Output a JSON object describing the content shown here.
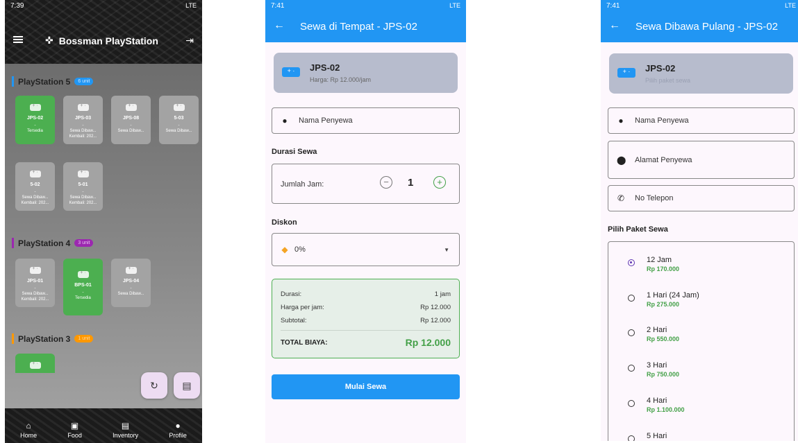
{
  "phone1": {
    "status": {
      "time": "7:39",
      "network": "LTE"
    },
    "app_title": "Bossman PlayStation",
    "sections": [
      {
        "name": "PlayStation 5",
        "badge": "6 unit",
        "color": "#2196f3",
        "units": [
          {
            "id": "JPS-02",
            "status": "Tersedia",
            "extra": "",
            "available": true
          },
          {
            "id": "JPS-03",
            "status": "Sewa Dibaw...",
            "extra": "Kembali: 202...",
            "available": false
          },
          {
            "id": "JPS-08",
            "status": "Sewa Dibaw...",
            "extra": "",
            "available": false
          },
          {
            "id": "5-03",
            "status": "Sewa Dibaw...",
            "extra": "",
            "available": false
          },
          {
            "id": "5-02",
            "status": "Sewa Dibaw...",
            "extra": "Kembali: 202...",
            "available": false
          },
          {
            "id": "5-01",
            "status": "Sewa Dibaw...",
            "extra": "Kembali: 202...",
            "available": false
          }
        ]
      },
      {
        "name": "PlayStation 4",
        "badge": "3 unit",
        "color": "#9c27b0",
        "units": [
          {
            "id": "JPS-01",
            "status": "Sewa Dibaw...",
            "extra": "Kembali: 202...",
            "available": false
          },
          {
            "id": "BPS-01",
            "status": "Tersedia",
            "extra": "",
            "available": true
          },
          {
            "id": "JPS-04",
            "status": "Sewa Dibaw...",
            "extra": "",
            "available": false
          }
        ]
      },
      {
        "name": "PlayStation 3",
        "badge": "1 unit",
        "color": "#ff9800",
        "units": []
      }
    ],
    "nav": [
      "Home",
      "Food",
      "Inventory",
      "Profile"
    ]
  },
  "phone2": {
    "status": {
      "time": "7:41",
      "network": "LTE"
    },
    "title": "Sewa di Tempat - JPS-02",
    "unit_id": "JPS-02",
    "price": "Harga: Rp 12.000/jam",
    "name_placeholder": "Nama Penyewa",
    "duration_label": "Durasi Sewa",
    "hours_label": "Jumlah Jam:",
    "hours_value": "1",
    "discount_label": "Diskon",
    "discount_value": "0%",
    "summary": {
      "rows": [
        {
          "label": "Durasi:",
          "value": "1 jam"
        },
        {
          "label": "Harga per jam:",
          "value": "Rp 12.000"
        },
        {
          "label": "Subtotal:",
          "value": "Rp 12.000"
        }
      ],
      "total_label": "TOTAL BIAYA:",
      "total_value": "Rp 12.000"
    },
    "start_button": "Mulai Sewa"
  },
  "phone3": {
    "status": {
      "time": "7:41",
      "network": "LTE"
    },
    "title": "Sewa Dibawa Pulang - JPS-02",
    "unit_id": "JPS-02",
    "subtitle": "Pilih paket sewa",
    "fields": [
      "Nama Penyewa",
      "Alamat Penyewa",
      "No Telepon"
    ],
    "packages_label": "Pilih Paket Sewa",
    "packages": [
      {
        "name": "12 Jam",
        "price": "Rp 170.000",
        "selected": true
      },
      {
        "name": "1 Hari (24 Jam)",
        "price": "Rp 275.000",
        "selected": false
      },
      {
        "name": "2 Hari",
        "price": "Rp 550.000",
        "selected": false
      },
      {
        "name": "3 Hari",
        "price": "Rp 750.000",
        "selected": false
      },
      {
        "name": "4 Hari",
        "price": "Rp 1.100.000",
        "selected": false
      },
      {
        "name": "5 Hari",
        "price": "",
        "selected": false
      }
    ]
  }
}
